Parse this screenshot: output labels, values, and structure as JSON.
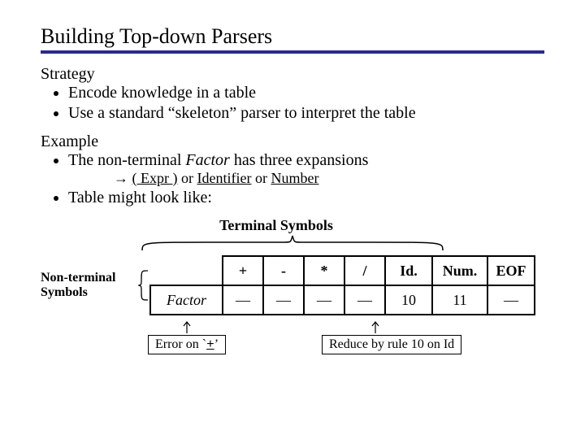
{
  "title": "Building Top-down Parsers",
  "strategy": {
    "label": "Strategy",
    "items": [
      "Encode knowledge in a table",
      "Use a standard “skeleton” parser to interpret the table"
    ]
  },
  "example": {
    "label": "Example",
    "line1_prefix": "The non-terminal ",
    "line1_factor": "Factor",
    "line1_suffix": " has three expansions",
    "expansion": {
      "arrow": "→",
      "alt1": "( Expr )",
      "or1": "or",
      "alt2": "Identifier",
      "or2": "or",
      "alt3": "Number"
    },
    "line2": "Table might look like:"
  },
  "terminal_label": "Terminal Symbols",
  "nonterminal_label": "Non-terminal Symbols",
  "table": {
    "row_header": "Factor",
    "cols": [
      "+",
      "-",
      "*",
      "/",
      "Id.",
      "Num.",
      "EOF"
    ],
    "cells": [
      "—",
      "—",
      "—",
      "—",
      "10",
      "11",
      "—"
    ]
  },
  "annot_error_prefix": "Error on `",
  "annot_error_sym": "+",
  "annot_error_suffix": "’",
  "annot_reduce": "Reduce by rule 10 on Id"
}
